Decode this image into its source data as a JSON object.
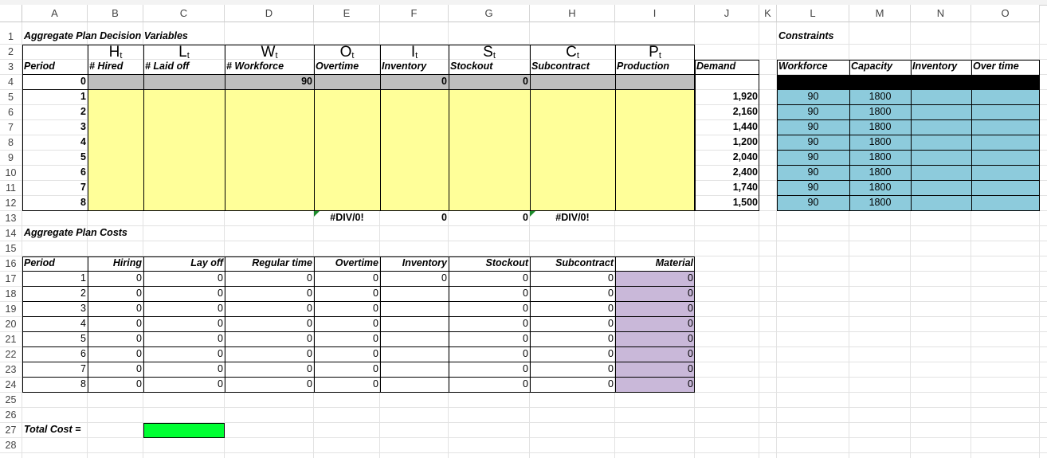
{
  "columns": [
    "A",
    "B",
    "C",
    "D",
    "E",
    "F",
    "G",
    "H",
    "I",
    "J",
    "K",
    "L",
    "M",
    "N",
    "O"
  ],
  "rows": [
    "1",
    "2",
    "3",
    "4",
    "5",
    "6",
    "7",
    "8",
    "9",
    "10",
    "11",
    "12",
    "13",
    "14",
    "15",
    "16",
    "17",
    "18",
    "19",
    "20",
    "21",
    "22",
    "23",
    "24",
    "25",
    "26",
    "27",
    "28"
  ],
  "decision": {
    "title": "Aggregate Plan Decision Variables",
    "symbols": [
      {
        "base": "H",
        "sub": "t"
      },
      {
        "base": "L",
        "sub": "t"
      },
      {
        "base": "W",
        "sub": "t"
      },
      {
        "base": "O",
        "sub": "t"
      },
      {
        "base": "I",
        "sub": "t"
      },
      {
        "base": "S",
        "sub": "t"
      },
      {
        "base": "C",
        "sub": "t"
      },
      {
        "base": "P",
        "sub": "t"
      }
    ],
    "headers": [
      "Period",
      "# Hired",
      "# Laid off",
      "# Workforce",
      "Overtime",
      "Inventory",
      "Stockout",
      "Subcontract",
      "Production",
      "Demand"
    ],
    "row0": {
      "period": "0",
      "workforce": "90",
      "inventory": "0",
      "stockout": "0"
    },
    "periods": [
      "1",
      "2",
      "3",
      "4",
      "5",
      "6",
      "7",
      "8"
    ],
    "demand": [
      "1,920",
      "2,160",
      "1,440",
      "1,200",
      "2,040",
      "2,400",
      "1,740",
      "1,500"
    ],
    "totals": {
      "overtime": "#DIV/0!",
      "inventory": "0",
      "stockout": "0",
      "subcontract": "#DIV/0!"
    }
  },
  "constraints": {
    "title": "Constraints",
    "headers": [
      "Workforce",
      "Capacity",
      "Inventory",
      "Over time"
    ],
    "workforce": [
      "90",
      "90",
      "90",
      "90",
      "90",
      "90",
      "90",
      "90"
    ],
    "capacity": [
      "1800",
      "1800",
      "1800",
      "1800",
      "1800",
      "1800",
      "1800",
      "1800"
    ]
  },
  "costs": {
    "title": "Aggregate Plan Costs",
    "headers": [
      "Period",
      "Hiring",
      "Lay off",
      "Regular time",
      "Overtime",
      "Inventory",
      "Stockout",
      "Subcontract",
      "Material"
    ],
    "rows": [
      [
        "1",
        "0",
        "0",
        "0",
        "0",
        "0",
        "0",
        "0",
        "0"
      ],
      [
        "2",
        "0",
        "0",
        "0",
        "0",
        "",
        "0",
        "0",
        "0"
      ],
      [
        "3",
        "0",
        "0",
        "0",
        "0",
        "",
        "0",
        "0",
        "0"
      ],
      [
        "4",
        "0",
        "0",
        "0",
        "0",
        "",
        "0",
        "0",
        "0"
      ],
      [
        "5",
        "0",
        "0",
        "0",
        "0",
        "",
        "0",
        "0",
        "0"
      ],
      [
        "6",
        "0",
        "0",
        "0",
        "0",
        "",
        "0",
        "0",
        "0"
      ],
      [
        "7",
        "0",
        "0",
        "0",
        "0",
        "",
        "0",
        "0",
        "0"
      ],
      [
        "8",
        "0",
        "0",
        "0",
        "0",
        "",
        "0",
        "0",
        "0"
      ]
    ],
    "total_label": "Total Cost ="
  },
  "colors": {
    "input": "#ffff99",
    "locked": "#bfbfbf",
    "constraint": "#8dcbdc",
    "material": "#c9b8d9",
    "total": "#00ff33"
  }
}
